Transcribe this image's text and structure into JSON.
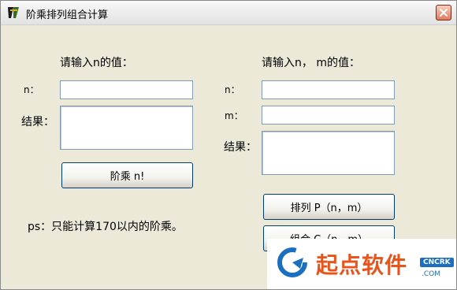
{
  "window": {
    "title": "阶乘排列组合计算",
    "icon": "app-icon",
    "close_icon": "close-icon"
  },
  "factorial": {
    "heading": "请输入n的值：",
    "n_label": "n：",
    "n_value": "",
    "result_label": "结果：",
    "result_value": "",
    "button_label": "阶乘 n!"
  },
  "permutation": {
    "heading": "请输入n， m的值：",
    "n_label": "n：",
    "n_value": "",
    "m_label": "m：",
    "m_value": "",
    "result_label": "结果：",
    "result_value": "",
    "perm_button_label": "排列 P（n，m）",
    "comb_button_label": "组合 C（n，m）"
  },
  "note": "ps：只能计算170以内的阶乘。",
  "watermark": {
    "logo_text": "起点软件",
    "badge": "CNCRK",
    "domain": ".COM"
  },
  "colors": {
    "window_bg": "#ECE9D8",
    "button_border": "#003c74",
    "input_border": "#7f9db9",
    "watermark_orange": "#e8541c",
    "watermark_blue": "#1b6fc1"
  }
}
